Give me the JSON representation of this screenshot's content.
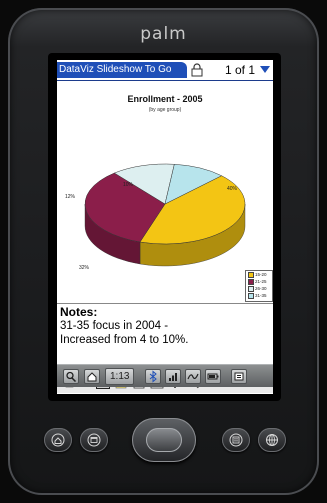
{
  "device": {
    "brand": "palm"
  },
  "app": {
    "title": "DataViz Slideshow To Go",
    "page_indicator": "1 of 1"
  },
  "chart_data": {
    "type": "pie",
    "title": "Enrollment - 2005",
    "subtitle": "(by age group)",
    "categories": [
      "15-20",
      "21-25",
      "26-30",
      "31-35"
    ],
    "values": [
      40,
      32,
      12,
      10
    ],
    "slice_labels": [
      "40%",
      "32%",
      "12%",
      "10%"
    ],
    "colors": {
      "15-20": "#f3c514",
      "21-25": "#8b1e4a",
      "26-30": "#ddeff0",
      "31-35": "#b7e4ec"
    },
    "legend": "bottom-right",
    "style": "3d"
  },
  "notes": {
    "heading": "Notes:",
    "lines": [
      "31-35 focus in 2004 -",
      "Increased from 4 to 10%."
    ]
  },
  "status_bar": {
    "time": "1:13"
  },
  "icons": {
    "toolbar": [
      "slide-show-icon",
      "outline-icon",
      "slide-view-icon",
      "notes-icon",
      "document-icon",
      "info-icon",
      "chart-icon",
      "search-icon"
    ],
    "status": [
      "search-icon",
      "home-icon",
      "time-display",
      "bluetooth-icon",
      "signal-icon",
      "brightness-icon",
      "battery-icon",
      "menu-icon"
    ],
    "hardware": [
      "home-button-icon",
      "calendar-button-icon",
      "center-navigator",
      "contacts-button-icon",
      "web-button-icon"
    ]
  }
}
